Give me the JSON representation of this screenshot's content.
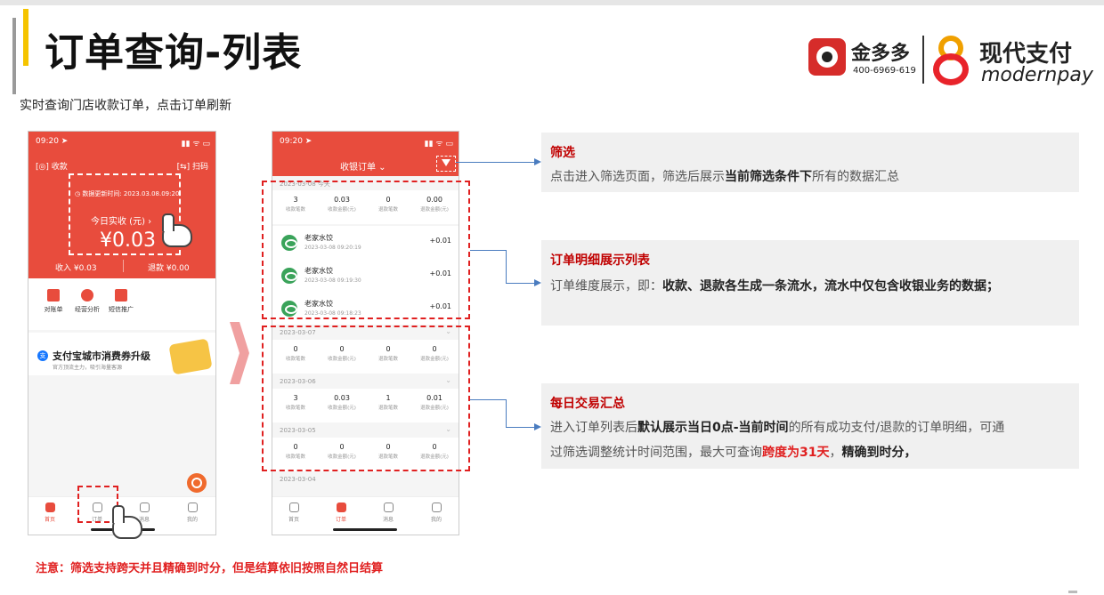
{
  "header": {
    "title": "订单查询-列表",
    "subtitle": "实时查询门店收款订单，点击订单刷新"
  },
  "logos": {
    "brand1_name": "金多多",
    "brand1_phone": "400-6969-619",
    "brand2_name": "现代支付",
    "brand2_en": "modernpay"
  },
  "phone1": {
    "status_time": "09:20 ➤",
    "status_icons": "▮▮ ᯤ ▭",
    "collect_label": "[◎] 收款",
    "scan_label": "[⇆] 扫码",
    "update_time": "◷ 数据更新时间: 2023.03.08.09:20",
    "today_label": "今日实收 (元) ›",
    "today_amount": "¥0.03",
    "income": "收入 ¥0.03",
    "refund": "退款 ¥0.00",
    "shortcuts": [
      "对账单",
      "经营分析",
      "短信推广"
    ],
    "promo_title": "支付宝城市消费券升级",
    "promo_sub": "官方顶流主力，吸引海量客源",
    "alipay_glyph": "支",
    "tabs": [
      "首页",
      "订单",
      "消息",
      "我的"
    ]
  },
  "phone2": {
    "status_time": "09:20 ➤",
    "status_icons": "▮▮ ᯤ ▭",
    "title": "收银订单 ⌄",
    "sum_labels": [
      "收款笔数",
      "收款金额(元)",
      "退款笔数",
      "退款金额(元)"
    ],
    "day1": {
      "date": "2023-03-08 今天",
      "sums": [
        "3",
        "0.03",
        "0",
        "0.00"
      ],
      "orders": [
        {
          "name": "老家水饺",
          "time": "2023-03-08 09:20:19",
          "amount": "+0.01"
        },
        {
          "name": "老家水饺",
          "time": "2023-03-08 09:19:30",
          "amount": "+0.01"
        },
        {
          "name": "老家水饺",
          "time": "2023-03-08 09:18:23",
          "amount": "+0.01"
        }
      ]
    },
    "day2": {
      "date": "2023-03-07",
      "sums": [
        "0",
        "0",
        "0",
        "0"
      ]
    },
    "day3": {
      "date": "2023-03-06",
      "sums": [
        "3",
        "0.03",
        "1",
        "0.01"
      ]
    },
    "day4": {
      "date": "2023-03-05",
      "sums": [
        "0",
        "0",
        "0",
        "0"
      ]
    },
    "day5": {
      "date": "2023-03-04"
    },
    "chevron": "⌄",
    "tabs": [
      "首页",
      "订单",
      "消息",
      "我的"
    ]
  },
  "callouts": {
    "filter_title": "筛选",
    "filter_body_1": "点击进入筛选页面，筛选后展示",
    "filter_body_bold": "当前筛选条件下",
    "filter_body_2": "所有的数据汇总",
    "detail_title": "订单明细展示列表",
    "detail_body_1": "订单维度展示，即：",
    "detail_body_bold": "收款、退款各生成一条流水，流水中仅包含收银业务的数据；",
    "daily_title": "每日交易汇总",
    "daily_body_1": "进入订单列表后",
    "daily_body_bold1": "默认展示当日0点-当前时间",
    "daily_body_2": "的所有成功支付/退款的订单明细，可通",
    "daily_body_3": "过筛选调整统计时间范围，最大可查询",
    "daily_body_red": "跨度为31天",
    "daily_body_4": "，",
    "daily_body_bold2": "精确到时分，"
  },
  "footer_note": "注意：筛选支持跨天并且精确到时分，但是结算依旧按照自然日结算",
  "colors": {
    "brand_red": "#e84c3d",
    "accent_yellow": "#f5c400",
    "note_red": "#e02020",
    "panel_title": "#c00000"
  }
}
